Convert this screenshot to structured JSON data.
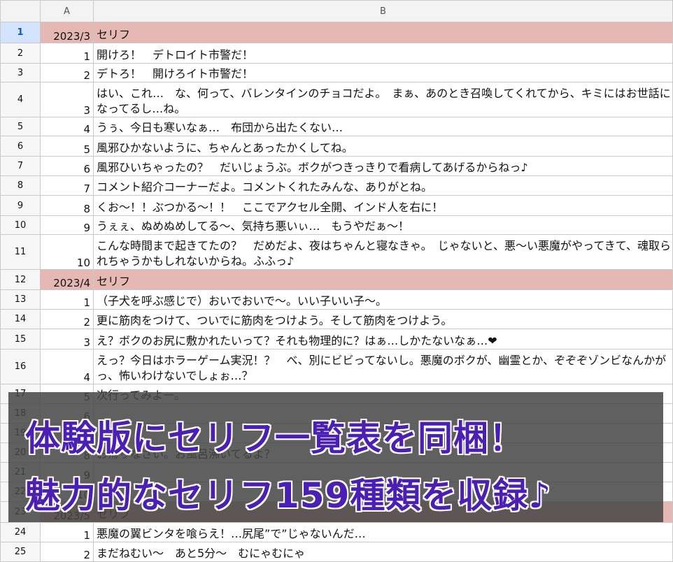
{
  "columns": {
    "a": "A",
    "b": "B"
  },
  "rows": [
    {
      "num": "1",
      "a": "2023/3",
      "b": "セリフ",
      "type": "header",
      "h": 30,
      "selected": true
    },
    {
      "num": "2",
      "a": "1",
      "b": "開けろ！　デトロイト市警だ！",
      "h": 29
    },
    {
      "num": "3",
      "a": "2",
      "b": "デトろ！　開けろイト市警だ！",
      "h": 27
    },
    {
      "num": "4",
      "a": "3",
      "b": "はい、これ…　な、何って、バレンタインのチョコだよ。　まぁ、あのとき召喚してくれてから、キミにはお世話になってるし…ね。",
      "h": 50
    },
    {
      "num": "5",
      "a": "4",
      "b": "うぅ、今日も寒いなぁ…　布団から出たくない…",
      "h": 27
    },
    {
      "num": "6",
      "a": "5",
      "b": "風邪ひかないように、ちゃんとあったかくしてね。",
      "h": 29
    },
    {
      "num": "7",
      "a": "6",
      "b": "風邪ひいちゃったの？　だいじょうぶ。ボクがつきっきりで看病してあげるからねっ♪",
      "h": 28
    },
    {
      "num": "8",
      "a": "7",
      "b": "コメント紹介コーナーだよ。コメントくれたみんな、ありがとね。",
      "h": 28
    },
    {
      "num": "9",
      "a": "8",
      "b": "くお～！！ぶつかる～！！　ここでアクセル全開、インド人を右に！",
      "h": 29
    },
    {
      "num": "10",
      "a": "9",
      "b": "うぇぇ、ぬめぬめしてる～、気持ち悪いぃ…　もうやだぁ～！",
      "h": 27
    },
    {
      "num": "11",
      "a": "10",
      "b": "こんな時間まで起きてたの？　だめだよ、夜はちゃんと寝なきゃ。　じゃないと、悪～い悪魔がやってきて、魂取られちゃうかもしれないからね。ふふっ♪",
      "h": 50
    },
    {
      "num": "12",
      "a": "2023/4",
      "b": "セリフ",
      "type": "header",
      "h": 29
    },
    {
      "num": "13",
      "a": "1",
      "b": "（子犬を呼ぶ感じで）おいでおいで～。いい子いい子～。",
      "h": 28
    },
    {
      "num": "14",
      "a": "2",
      "b": "更に筋肉をつけて、ついでに筋肉をつけよう。そして筋肉をつけよう。",
      "h": 28
    },
    {
      "num": "15",
      "a": "3",
      "b": "え？ボクのお尻に敷かれたいって？それも物理的に？はぁ…しかたないなぁ…❤",
      "h": 29
    },
    {
      "num": "16",
      "a": "4",
      "b": "えっ？今日はホラーゲーム実況！？　べ、別にビビってないし。悪魔のボクが、幽霊とか、ぞぞぞゾンビなんかがっ、怖いわけないでしょぉ…？",
      "h": 50
    },
    {
      "num": "17",
      "a": "5",
      "b": "次行ってみよー。",
      "h": 28
    },
    {
      "num": "18",
      "a": "6",
      "b": "",
      "h": 28
    },
    {
      "num": "19",
      "a": "7",
      "b": "",
      "h": 28
    },
    {
      "num": "20",
      "a": "8",
      "b": "お帰りなさい。お風呂沸いてるよ？",
      "h": 28
    },
    {
      "num": "21",
      "a": "9",
      "b": "",
      "h": 28
    },
    {
      "num": "22",
      "a": "10",
      "b": "",
      "h": 28
    },
    {
      "num": "23",
      "a": "2023/5",
      "b": "セリフ",
      "type": "header",
      "h": 30
    },
    {
      "num": "24",
      "a": "1",
      "b": "悪魔の翼ビンタを喰らえ！…尻尾”で”じゃないんだ…",
      "h": 28
    },
    {
      "num": "25",
      "a": "2",
      "b": "まだねむい～　あと5分～　むにゃむにゃ",
      "h": 28
    }
  ],
  "banner": {
    "line1": "体験版にセリフ一覧表を同梱！",
    "line2": "魅力的なセリフ159種類を収録♪"
  },
  "colors": {
    "header_row": "#e6b8b3",
    "banner_text": "#4b1fb3",
    "banner_bg": "#464646"
  }
}
